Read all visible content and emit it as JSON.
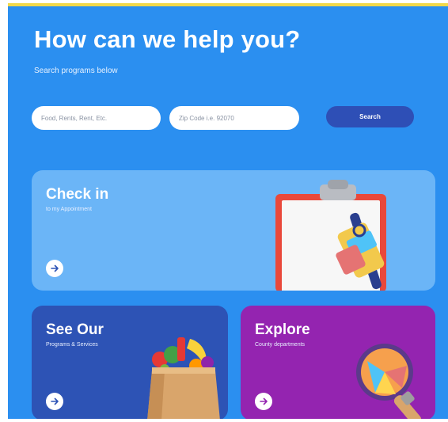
{
  "hero": {
    "title": "How can we help you?",
    "subtitle": "Search programs below"
  },
  "search": {
    "keyword_placeholder": "Food, Rents, Rent, Etc.",
    "zip_placeholder": "Zip Code i.e. 92070",
    "button_label": "Search"
  },
  "cards": {
    "checkin": {
      "title": "Check in",
      "subtitle": "to my Appointment",
      "icon": "clipboard-icon"
    },
    "see_our": {
      "title": "See Our",
      "subtitle": "Programs & Services",
      "icon": "grocery-bag-icon"
    },
    "explore": {
      "title": "Explore",
      "subtitle": "County departments",
      "icon": "magnifier-icon"
    }
  },
  "colors": {
    "background": "#2b8ff0",
    "accent_line": "#f2d94a",
    "search_button": "#2e4fb6",
    "card_checkin": "#6bb5f7",
    "card_see_our": "#2d53b5",
    "card_explore": "#9424b0"
  }
}
